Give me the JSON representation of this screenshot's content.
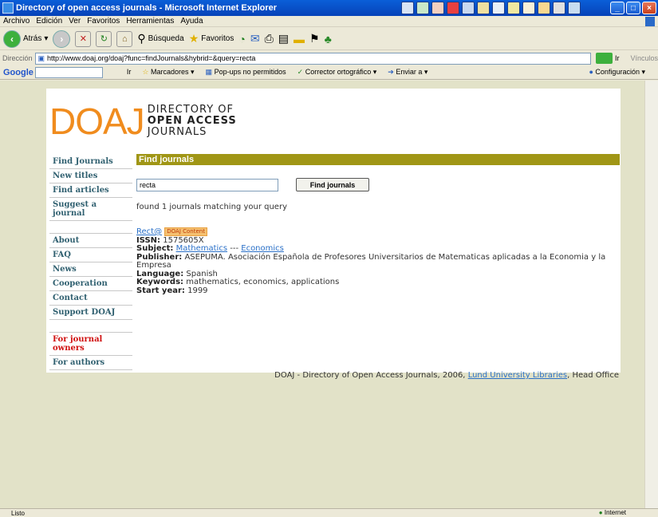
{
  "window": {
    "title": "Directory of open access journals - Microsoft Internet Explorer"
  },
  "menu": [
    "Archivo",
    "Edición",
    "Ver",
    "Favoritos",
    "Herramientas",
    "Ayuda"
  ],
  "toolbar": {
    "back": "Atrás",
    "search": "Búsqueda",
    "favorites": "Favoritos"
  },
  "address": {
    "label": "Dirección",
    "url": "http://www.doaj.org/doaj?func=findJournals&hybrid=&query=recta",
    "go": "Ir",
    "links": "Vínculos"
  },
  "google_bar": {
    "logo": "Google",
    "go": "Ir",
    "bookmarks": "Marcadores",
    "popups": "Pop-ups no permitidos",
    "spell": "Corrector ortográfico",
    "send": "Enviar a",
    "config": "Configuración"
  },
  "logo": {
    "mark": "DOAJ",
    "line1": "DIRECTORY OF",
    "line2": "OPEN ACCESS",
    "line3": "JOURNALS"
  },
  "sidenav": {
    "group1": [
      "Find Journals",
      "New titles",
      "Find articles",
      "Suggest a journal"
    ],
    "group2": [
      "About",
      "FAQ",
      "News",
      "Cooperation",
      "Contact",
      "Support DOAJ"
    ],
    "owners": "For journal owners",
    "authors": "For authors"
  },
  "main": {
    "header": "Find journals",
    "search_value": "recta",
    "search_button": "Find journals",
    "found": "found 1 journals matching your query"
  },
  "result": {
    "title": "Rect@",
    "badge": "DOAJ Content",
    "issn_label": "ISSN:",
    "issn": "1575605X",
    "subject_label": "Subject:",
    "subject1": "Mathematics",
    "subject_sep": "---",
    "subject2": "Economics",
    "publisher_label": "Publisher:",
    "publisher": "ASEPUMA. Asociación Española de Profesores Universitarios de Matematicas aplicadas a la Economia y la Empresa",
    "language_label": "Language:",
    "language": "Spanish",
    "keywords_label": "Keywords:",
    "keywords": "mathematics, economics, applications",
    "start_label": "Start year:",
    "start": "1999"
  },
  "footer": {
    "prefix": "DOAJ - Directory of Open Access Journals, 2006,",
    "link": "Lund University Libraries",
    "suffix": "Head Office"
  },
  "status": {
    "left": "Listo",
    "zone": "Internet"
  }
}
